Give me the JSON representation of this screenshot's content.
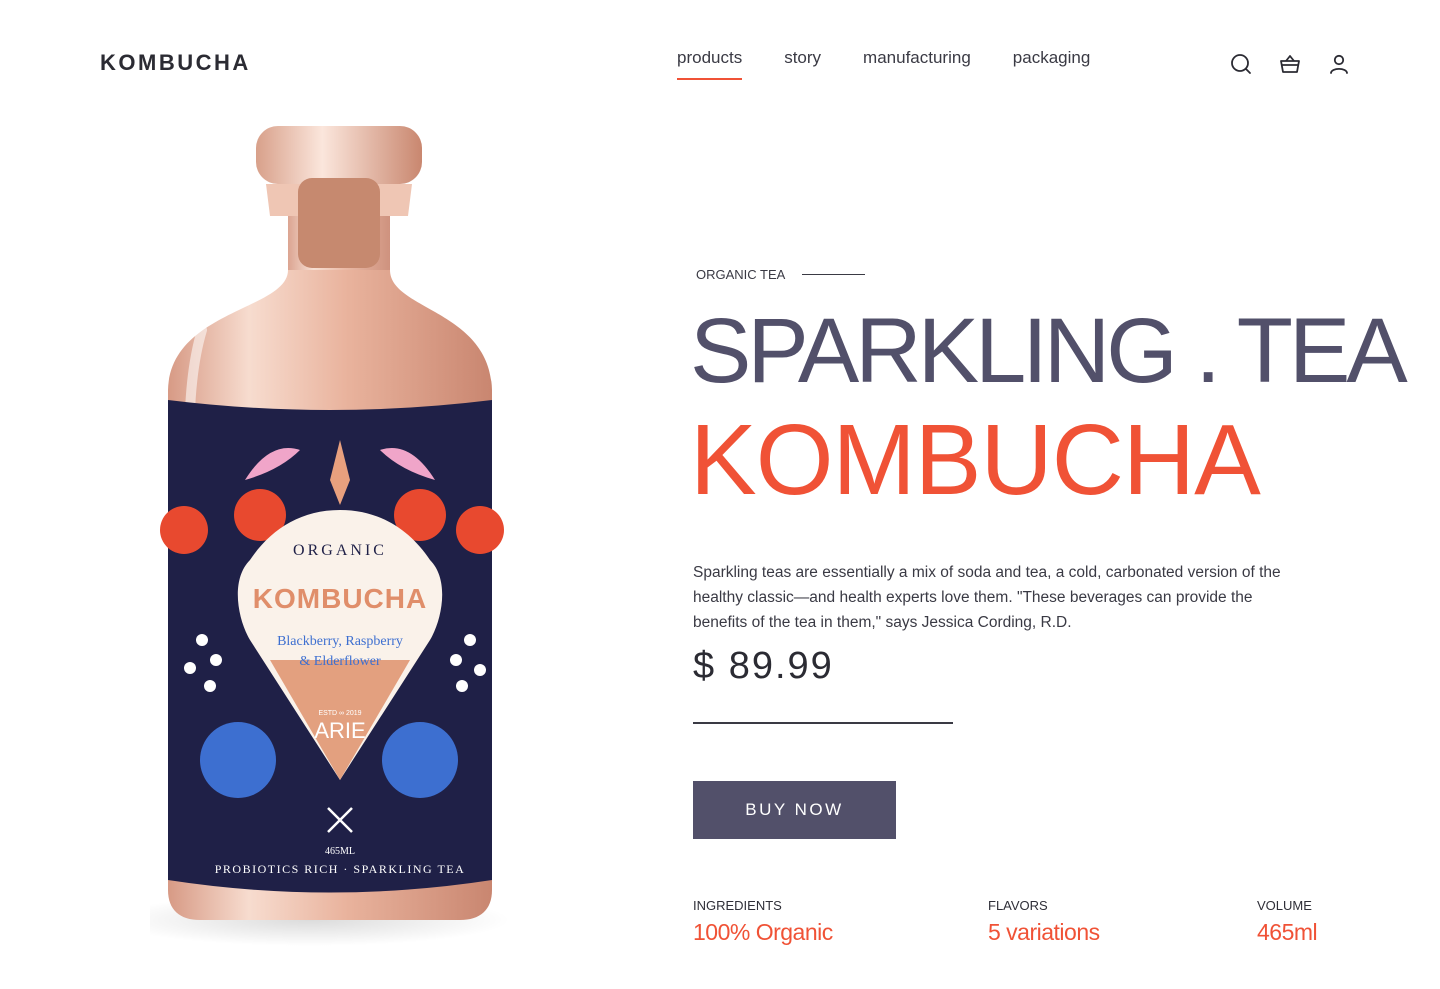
{
  "brand": {
    "logo": "KOMBUCHA"
  },
  "nav": {
    "items": [
      {
        "label": "products",
        "active": true
      },
      {
        "label": "story",
        "active": false
      },
      {
        "label": "manufacturing",
        "active": false
      },
      {
        "label": "packaging",
        "active": false
      }
    ]
  },
  "header_icons": [
    "search-icon",
    "basket-icon",
    "user-icon"
  ],
  "product_label": {
    "top": "ORGANIC",
    "brand": "KOMBUCHA",
    "flavor_line1": "Blackberry, Raspberry",
    "flavor_line2": "& Elderflower",
    "estd": "ESTD ∞ 2019",
    "maker": "ARIE",
    "volume": "465ML",
    "tagline": "PROBIOTICS RICH · SPARKLING TEA"
  },
  "hero": {
    "eyebrow": "ORGANIC TEA",
    "headline_1": "SPARKLING . TEA",
    "headline_2": "KOMBUCHA",
    "description": "Sparkling teas are essentially a mix of soda and tea, a cold, carbonated version of the healthy classic—and health experts love them. \"These beverages can provide the benefits of the tea in them,\" says Jessica Cording, R.D.",
    "price": "$ 89.99",
    "cta": "BUY NOW"
  },
  "stats": [
    {
      "label": "INGREDIENTS",
      "value": "100% Organic"
    },
    {
      "label": "FLAVORS",
      "value": "5 variations"
    },
    {
      "label": "VOLUME",
      "value": "465ml"
    }
  ],
  "colors": {
    "accent": "#f05236",
    "primary": "#52506a",
    "label_bg": "#1f2047"
  }
}
